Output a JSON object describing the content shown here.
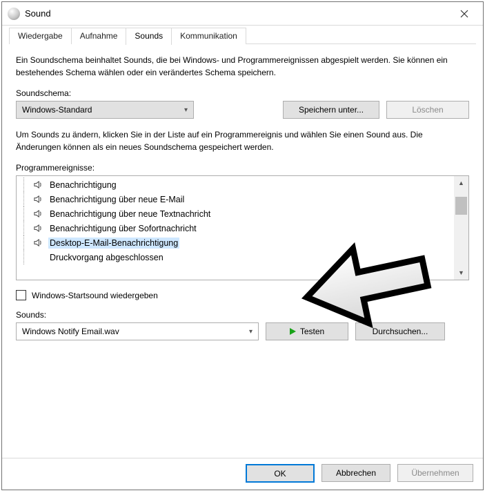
{
  "window": {
    "title": "Sound"
  },
  "tabs": [
    "Wiedergabe",
    "Aufnahme",
    "Sounds",
    "Kommunikation"
  ],
  "active_tab": 2,
  "desc1": "Ein Soundschema beinhaltet Sounds, die bei Windows- und Programmereignissen abgespielt werden. Sie können ein bestehendes Schema wählen oder ein verändertes Schema speichern.",
  "scheme_label": "Soundschema:",
  "scheme_value": "Windows-Standard",
  "save_as_label": "Speichern unter...",
  "delete_label": "Löschen",
  "desc2": "Um Sounds zu ändern, klicken Sie in der Liste auf ein Programmereignis und wählen Sie einen Sound aus. Die Änderungen können als ein neues Soundschema gespeichert werden.",
  "events_label": "Programmereignisse:",
  "events": [
    {
      "label": "Benachrichtigung",
      "has_sound": true,
      "selected": false
    },
    {
      "label": "Benachrichtigung über neue E-Mail",
      "has_sound": true,
      "selected": false
    },
    {
      "label": "Benachrichtigung über neue Textnachricht",
      "has_sound": true,
      "selected": false
    },
    {
      "label": "Benachrichtigung über Sofortnachricht",
      "has_sound": true,
      "selected": false
    },
    {
      "label": "Desktop-E-Mail-Benachrichtigung",
      "has_sound": true,
      "selected": true
    },
    {
      "label": "Druckvorgang abgeschlossen",
      "has_sound": false,
      "selected": false
    }
  ],
  "play_start_label": "Windows-Startsound wiedergeben",
  "sounds_label": "Sounds:",
  "sound_value": "Windows Notify Email.wav",
  "test_label": "Testen",
  "browse_label": "Durchsuchen...",
  "ok_label": "OK",
  "cancel_label": "Abbrechen",
  "apply_label": "Übernehmen"
}
